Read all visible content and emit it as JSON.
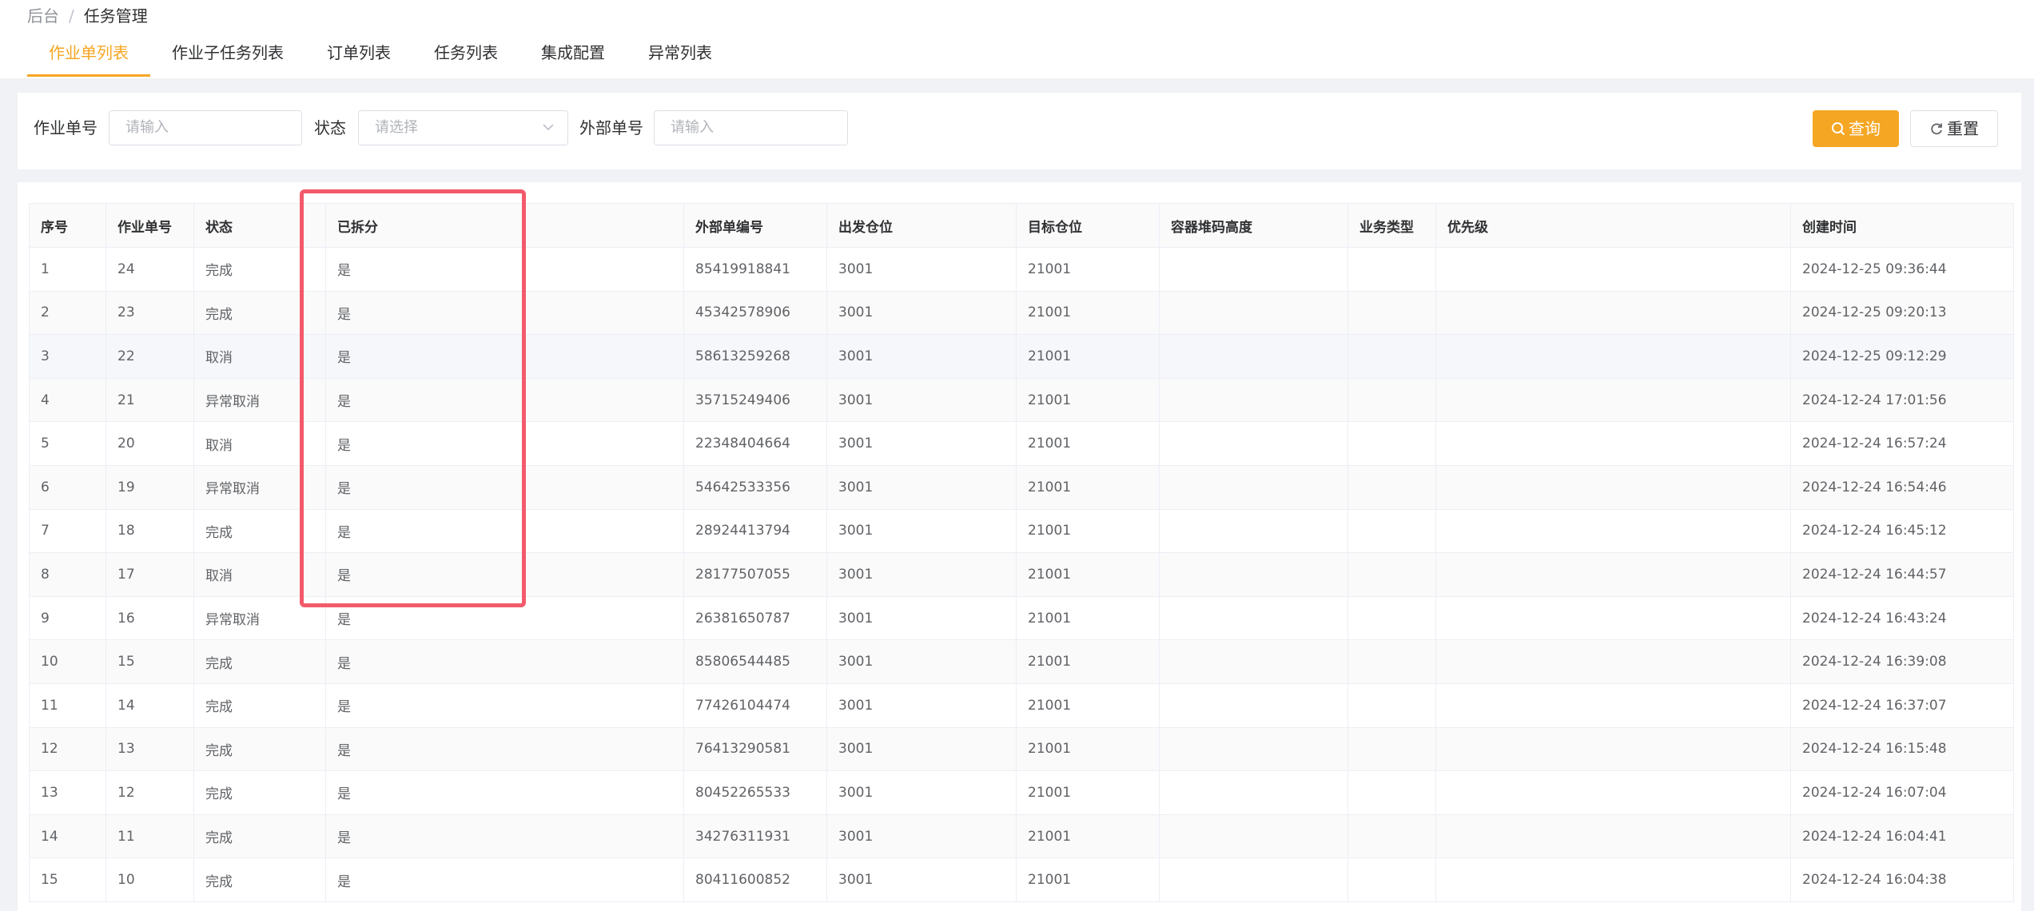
{
  "breadcrumb": {
    "home": "后台",
    "separator": "/",
    "current": "任务管理"
  },
  "tabs": [
    {
      "label": "作业单列表",
      "active": true
    },
    {
      "label": "作业子任务列表"
    },
    {
      "label": "订单列表"
    },
    {
      "label": "任务列表"
    },
    {
      "label": "集成配置"
    },
    {
      "label": "异常列表"
    }
  ],
  "filters": {
    "order_no": {
      "label": "作业单号",
      "placeholder": "请输入"
    },
    "status": {
      "label": "状态",
      "placeholder": "请选择"
    },
    "external_no": {
      "label": "外部单号",
      "placeholder": "请输入"
    }
  },
  "buttons": {
    "query": "查询",
    "reset": "重置"
  },
  "colors": {
    "accent": "#f5a623",
    "highlight": "#f35a6b"
  },
  "table": {
    "columns": [
      "序号",
      "作业单号",
      "状态",
      "已拆分",
      "外部单编号",
      "出发仓位",
      "目标仓位",
      "容器堆码高度",
      "业务类型",
      "优先级",
      "创建时间"
    ],
    "rows": [
      [
        "1",
        "24",
        "完成",
        "是",
        "85419918841",
        "3001",
        "21001",
        "",
        "",
        "",
        "2024-12-25 09:36:44"
      ],
      [
        "2",
        "23",
        "完成",
        "是",
        "45342578906",
        "3001",
        "21001",
        "",
        "",
        "",
        "2024-12-25 09:20:13"
      ],
      [
        "3",
        "22",
        "取消",
        "是",
        "58613259268",
        "3001",
        "21001",
        "",
        "",
        "",
        "2024-12-25 09:12:29"
      ],
      [
        "4",
        "21",
        "异常取消",
        "是",
        "35715249406",
        "3001",
        "21001",
        "",
        "",
        "",
        "2024-12-24 17:01:56"
      ],
      [
        "5",
        "20",
        "取消",
        "是",
        "22348404664",
        "3001",
        "21001",
        "",
        "",
        "",
        "2024-12-24 16:57:24"
      ],
      [
        "6",
        "19",
        "异常取消",
        "是",
        "54642533356",
        "3001",
        "21001",
        "",
        "",
        "",
        "2024-12-24 16:54:46"
      ],
      [
        "7",
        "18",
        "完成",
        "是",
        "28924413794",
        "3001",
        "21001",
        "",
        "",
        "",
        "2024-12-24 16:45:12"
      ],
      [
        "8",
        "17",
        "取消",
        "是",
        "28177507055",
        "3001",
        "21001",
        "",
        "",
        "",
        "2024-12-24 16:44:57"
      ],
      [
        "9",
        "16",
        "异常取消",
        "是",
        "26381650787",
        "3001",
        "21001",
        "",
        "",
        "",
        "2024-12-24 16:43:24"
      ],
      [
        "10",
        "15",
        "完成",
        "是",
        "85806544485",
        "3001",
        "21001",
        "",
        "",
        "",
        "2024-12-24 16:39:08"
      ],
      [
        "11",
        "14",
        "完成",
        "是",
        "77426104474",
        "3001",
        "21001",
        "",
        "",
        "",
        "2024-12-24 16:37:07"
      ],
      [
        "12",
        "13",
        "完成",
        "是",
        "76413290581",
        "3001",
        "21001",
        "",
        "",
        "",
        "2024-12-24 16:15:48"
      ],
      [
        "13",
        "12",
        "完成",
        "是",
        "80452265533",
        "3001",
        "21001",
        "",
        "",
        "",
        "2024-12-24 16:07:04"
      ],
      [
        "14",
        "11",
        "完成",
        "是",
        "34276311931",
        "3001",
        "21001",
        "",
        "",
        "",
        "2024-12-24 16:04:41"
      ],
      [
        "15",
        "10",
        "完成",
        "是",
        "80411600852",
        "3001",
        "21001",
        "",
        "",
        "",
        "2024-12-24 16:04:38"
      ]
    ]
  }
}
